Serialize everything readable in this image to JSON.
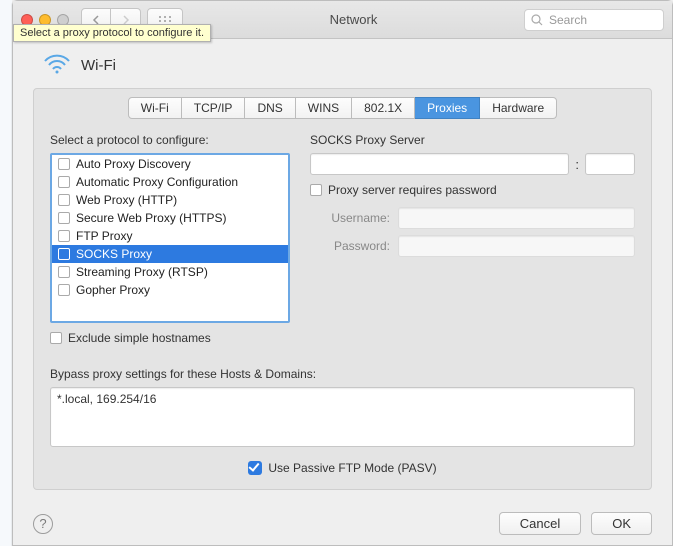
{
  "window_title": "Network",
  "tooltip": "Select a proxy protocol to configure it.",
  "search_placeholder": "Search",
  "connection_name": "Wi-Fi",
  "tabs": [
    "Wi-Fi",
    "TCP/IP",
    "DNS",
    "WINS",
    "802.1X",
    "Proxies",
    "Hardware"
  ],
  "active_tab_index": 5,
  "protocol_label": "Select a protocol to configure:",
  "protocols": [
    {
      "label": "Auto Proxy Discovery",
      "checked": false
    },
    {
      "label": "Automatic Proxy Configuration",
      "checked": false
    },
    {
      "label": "Web Proxy (HTTP)",
      "checked": false
    },
    {
      "label": "Secure Web Proxy (HTTPS)",
      "checked": false
    },
    {
      "label": "FTP Proxy",
      "checked": false
    },
    {
      "label": "SOCKS Proxy",
      "checked": false,
      "selected": true
    },
    {
      "label": "Streaming Proxy (RTSP)",
      "checked": false
    },
    {
      "label": "Gopher Proxy",
      "checked": false
    }
  ],
  "exclude_simple_label": "Exclude simple hostnames",
  "server_section_label": "SOCKS Proxy Server",
  "server_host": "",
  "server_port": "",
  "requires_password_label": "Proxy server requires password",
  "username_label": "Username:",
  "password_label": "Password:",
  "bypass_label": "Bypass proxy settings for these Hosts & Domains:",
  "bypass_value": "*.local, 169.254/16",
  "passive_ftp_label": "Use Passive FTP Mode (PASV)",
  "cancel_label": "Cancel",
  "ok_label": "OK"
}
